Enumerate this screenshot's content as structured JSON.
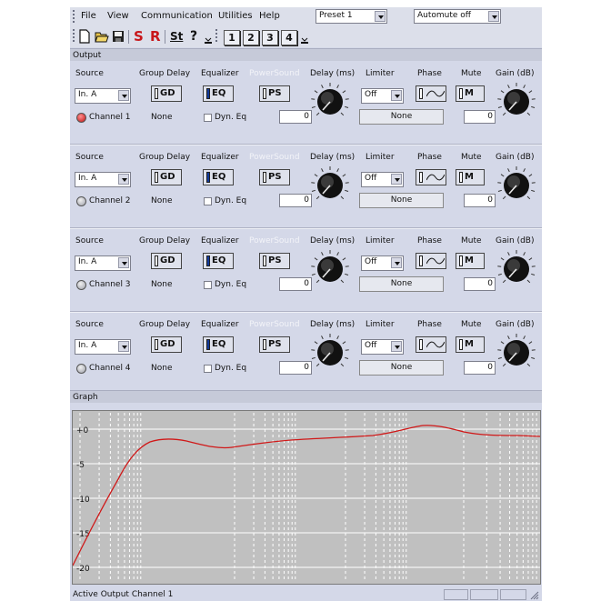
{
  "menu": {
    "file": "File",
    "view": "View",
    "communication": "Communication",
    "utilities": "Utilities",
    "help": "Help"
  },
  "preset_select": {
    "value": "Preset 1"
  },
  "automute_select": {
    "value": "Automute off"
  },
  "toolbar": {
    "send": "S",
    "receive": "R",
    "settings": "St",
    "help": "?",
    "btn1": "1",
    "btn2": "2",
    "btn3": "3",
    "btn4": "4"
  },
  "output_header": "Output",
  "column_labels": {
    "source": "Source",
    "group_delay": "Group Delay",
    "equalizer": "Equalizer",
    "powersound": "PowerSound",
    "delay": "Delay (ms)",
    "limiter": "Limiter",
    "phase": "Phase",
    "mute": "Mute",
    "gain": "Gain (dB)"
  },
  "button_labels": {
    "gd": "GD",
    "eq": "EQ",
    "ps": "PS",
    "m": "M",
    "dyn_eq": "Dyn. Eq"
  },
  "channels": [
    {
      "name": "Channel 1",
      "source": "In. A",
      "group_delay_value": "None",
      "delay": "0",
      "limiter": "Off",
      "limiter_preset": "None",
      "gain": "0",
      "active": true
    },
    {
      "name": "Channel 2",
      "source": "In. A",
      "group_delay_value": "None",
      "delay": "0",
      "limiter": "Off",
      "limiter_preset": "None",
      "gain": "0",
      "active": false
    },
    {
      "name": "Channel 3",
      "source": "In. A",
      "group_delay_value": "None",
      "delay": "0",
      "limiter": "Off",
      "limiter_preset": "None",
      "gain": "0",
      "active": false
    },
    {
      "name": "Channel 4",
      "source": "In. A",
      "group_delay_value": "None",
      "delay": "0",
      "limiter": "Off",
      "limiter_preset": "None",
      "gain": "0",
      "active": false
    }
  ],
  "graph_header": "Graph",
  "graph": {
    "y_ticks": [
      "+0",
      "-5",
      "-10",
      "-15",
      "-20"
    ],
    "curve_color": "#d01818",
    "grid_color": "#ffffff",
    "background_color": "#c0c0c0"
  },
  "status_bar": {
    "text": "Active Output Channel 1"
  },
  "colors": {
    "window_bg": "#d4d8e8",
    "eq_indicator": "#123a9c",
    "led_active": "#c01010"
  }
}
